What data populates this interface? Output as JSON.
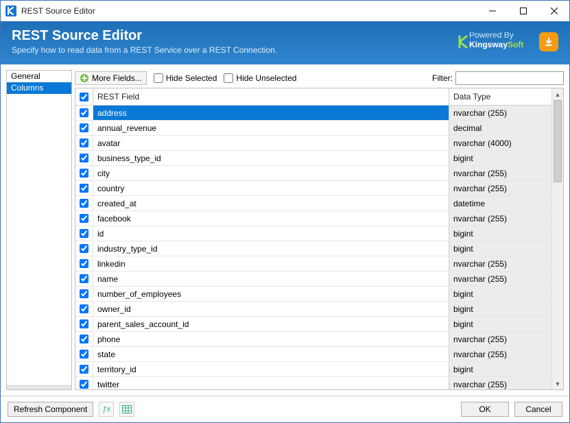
{
  "window": {
    "title": "REST Source Editor"
  },
  "header": {
    "title": "REST Source Editor",
    "subtitle": "Specify how to read data from a REST Service over a REST Connection.",
    "brand_powered": "Powered By",
    "brand_name1": "Kingsway",
    "brand_name2": "Soft"
  },
  "sidebar": {
    "items": [
      {
        "label": "General",
        "selected": false
      },
      {
        "label": "Columns",
        "selected": true
      }
    ]
  },
  "toolbar": {
    "more_fields": "More Fields...",
    "hide_selected": "Hide Selected",
    "hide_unselected": "Hide Unselected",
    "filter_label": "Filter:",
    "filter_value": ""
  },
  "grid": {
    "header_check": true,
    "col_field": "REST Field",
    "col_type": "Data Type",
    "rows": [
      {
        "checked": true,
        "field": "address",
        "type": "nvarchar (255)",
        "selected": true
      },
      {
        "checked": true,
        "field": "annual_revenue",
        "type": "decimal"
      },
      {
        "checked": true,
        "field": "avatar",
        "type": "nvarchar (4000)"
      },
      {
        "checked": true,
        "field": "business_type_id",
        "type": "bigint"
      },
      {
        "checked": true,
        "field": "city",
        "type": "nvarchar (255)"
      },
      {
        "checked": true,
        "field": "country",
        "type": "nvarchar (255)"
      },
      {
        "checked": true,
        "field": "created_at",
        "type": "datetime"
      },
      {
        "checked": true,
        "field": "facebook",
        "type": "nvarchar (255)"
      },
      {
        "checked": true,
        "field": "id",
        "type": "bigint"
      },
      {
        "checked": true,
        "field": "industry_type_id",
        "type": "bigint"
      },
      {
        "checked": true,
        "field": "linkedin",
        "type": "nvarchar (255)"
      },
      {
        "checked": true,
        "field": "name",
        "type": "nvarchar (255)"
      },
      {
        "checked": true,
        "field": "number_of_employees",
        "type": "bigint"
      },
      {
        "checked": true,
        "field": "owner_id",
        "type": "bigint"
      },
      {
        "checked": true,
        "field": "parent_sales_account_id",
        "type": "bigint"
      },
      {
        "checked": true,
        "field": "phone",
        "type": "nvarchar (255)"
      },
      {
        "checked": true,
        "field": "state",
        "type": "nvarchar (255)"
      },
      {
        "checked": true,
        "field": "territory_id",
        "type": "bigint"
      },
      {
        "checked": true,
        "field": "twitter",
        "type": "nvarchar (255)"
      }
    ]
  },
  "footer": {
    "refresh": "Refresh Component",
    "ok": "OK",
    "cancel": "Cancel"
  }
}
